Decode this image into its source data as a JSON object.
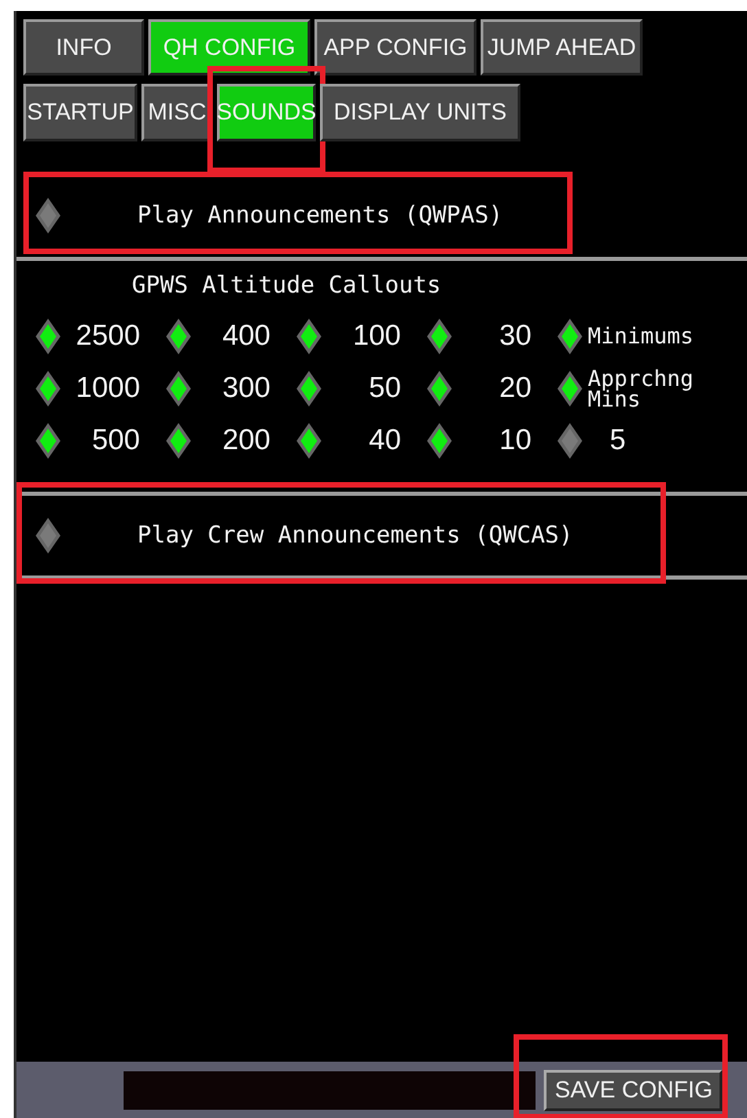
{
  "tabs": [
    {
      "label": "INFO",
      "selected": false
    },
    {
      "label": "QH CONFIG",
      "selected": true
    },
    {
      "label": "APP CONFIG",
      "selected": false
    },
    {
      "label": "JUMP AHEAD",
      "selected": false
    }
  ],
  "subtabs": [
    {
      "label": "STARTUP",
      "selected": false,
      "highlighted": false
    },
    {
      "label": "MISC",
      "selected": false,
      "highlighted": false
    },
    {
      "label": "SOUNDS",
      "selected": true,
      "highlighted": true
    },
    {
      "label": "DISPLAY UNITS",
      "selected": false,
      "highlighted": false
    }
  ],
  "announcements": {
    "label": "Play Announcements (QWPAS)",
    "checked": false,
    "highlighted": true
  },
  "callouts_title": "GPWS Altitude Callouts",
  "callouts": [
    {
      "label": "2500",
      "checked": true
    },
    {
      "label": "400",
      "checked": true
    },
    {
      "label": "100",
      "checked": true
    },
    {
      "label": "30",
      "checked": true
    },
    {
      "label": "Minimums",
      "checked": true
    },
    {
      "label": "1000",
      "checked": true
    },
    {
      "label": "300",
      "checked": true
    },
    {
      "label": "50",
      "checked": true
    },
    {
      "label": "20",
      "checked": true
    },
    {
      "label": "Apprchng Mins",
      "checked": true
    },
    {
      "label": "500",
      "checked": true
    },
    {
      "label": "200",
      "checked": true
    },
    {
      "label": "40",
      "checked": true
    },
    {
      "label": "10",
      "checked": true
    },
    {
      "label": "5",
      "checked": false
    }
  ],
  "crew_announcements": {
    "label": "Play Crew Announcements (QWCAS)",
    "checked": false,
    "highlighted": true
  },
  "save_button": {
    "label": "SAVE CONFIG",
    "highlighted": true
  }
}
